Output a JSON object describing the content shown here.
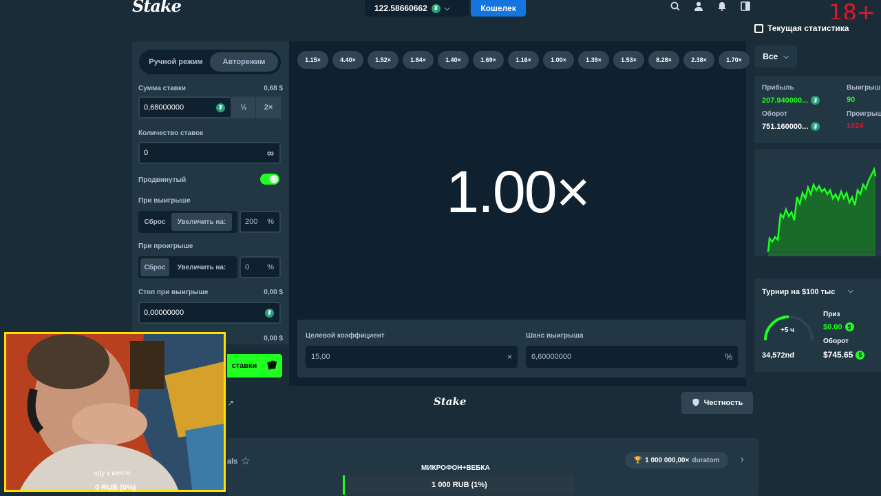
{
  "header": {
    "logo": "Stake",
    "balance": "122.58660662",
    "wallet_label": "Кошелек",
    "age_badge": "18+"
  },
  "sidebar": {
    "tab_manual": "Ручной режим",
    "tab_auto": "Авторежим",
    "bet_amount_label": "Сумма ставки",
    "bet_amount_usd": "0,68 $",
    "bet_amount_value": "0,68000000",
    "half_label": "½",
    "double_label": "2×",
    "bet_count_label": "Количество ставок",
    "bet_count_value": "0",
    "infinity": "∞",
    "advanced_label": "Продвинутый",
    "on_win_label": "При выигрыше",
    "on_win_reset": "Сброс",
    "on_win_increase": "Увеличить на:",
    "on_win_pct": "200",
    "on_loss_label": "При проигрыше",
    "on_loss_reset": "Сброс",
    "on_loss_increase": "Увеличить на:",
    "on_loss_pct": "0",
    "pct_sign": "%",
    "stop_win_label": "Стоп при выигрыше",
    "stop_win_usd": "0,00 $",
    "stop_win_value": "0,00000000",
    "stop_loss_usd": "0,00 $",
    "bet_button": "ставки"
  },
  "game": {
    "history": [
      "1.15×",
      "4.40×",
      "1.52×",
      "1.84×",
      "1.40×",
      "1.69×",
      "1.16×",
      "1.00×",
      "1.39×",
      "1.53×",
      "8.28×",
      "2.38×",
      "1.70×"
    ],
    "multiplier": "1.00×",
    "target_label": "Целевой коэффициент",
    "target_value": "15,00",
    "chance_label": "Шанс выигрыша",
    "chance_value": "6,60000000",
    "clear_icon": "×",
    "percent_icon": "%"
  },
  "footer": {
    "logo": "Stake",
    "fairness": "Честность",
    "left_text": "als",
    "prize_amount": "1 000 000,00×",
    "prize_user": "duratom"
  },
  "stream": {
    "mic_label": "МИКРОФОН+ВЕБКА",
    "progress_label": "1 000 RUB (1%)",
    "progress_fraction": 0.01,
    "cam_caption": "иду к мечте",
    "cam_rub": "0 RUB (0%)"
  },
  "stats": {
    "title": "Текущая статистика",
    "filter": "Все",
    "profit_label": "Прибыль",
    "profit_value": "207.940000...",
    "wins_label": "Выигрыш",
    "wins_value": "90",
    "turnover_label": "Оборот",
    "turnover_value": "751.160000...",
    "losses_label": "Проигрыш",
    "losses_value": "1024",
    "tournament_title": "Турнир на $100 тыс",
    "timer": "+5 ч",
    "rank": "34,572nd",
    "prize_label": "Приз",
    "prize_value": "$0.00",
    "t_turnover_label": "Оборот",
    "t_turnover_value": "$745.65"
  },
  "colors": {
    "accent_green": "#1fff20",
    "wallet_blue": "#1475e1",
    "loss_red": "#e0182b",
    "tether_green": "#26a17b"
  }
}
